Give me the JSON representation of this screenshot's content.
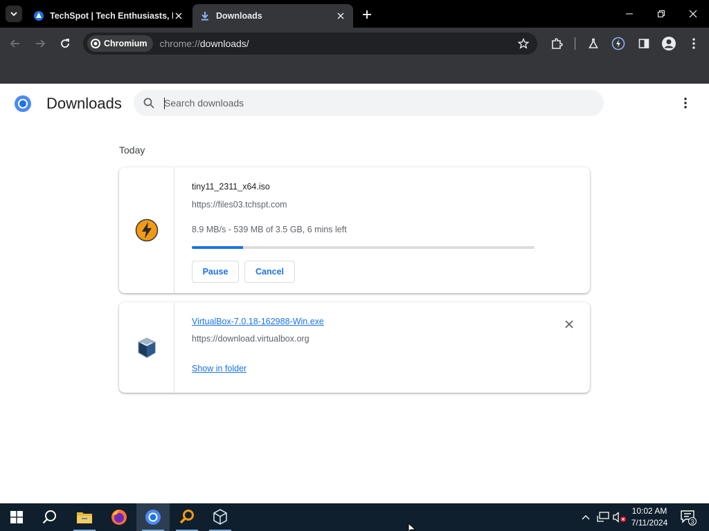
{
  "browser": {
    "tabs": [
      {
        "title": "TechSpot | Tech Enthusiasts, Po",
        "active": false
      },
      {
        "title": "Downloads",
        "active": true
      }
    ],
    "omnibox": {
      "chip_label": "Chromium",
      "url_scheme": "chrome://",
      "url_path": "downloads/"
    }
  },
  "downloads_page": {
    "title": "Downloads",
    "search": {
      "placeholder": "Search downloads",
      "value": ""
    },
    "section_label": "Today",
    "items": [
      {
        "filename": "tiny11_2311_x64.iso",
        "source": "https://files03.tchspt.com",
        "status": "8.9 MB/s - 539 MB of 3.5 GB, 6 mins left",
        "progress_percent": 15,
        "buttons": [
          "Pause",
          "Cancel"
        ],
        "icon": "lightning-bolt-icon"
      },
      {
        "filename": "VirtualBox-7.0.18-162988-Win.exe",
        "source": "https://download.virtualbox.org",
        "action": "Show in folder",
        "icon": "virtualbox-cube-icon"
      }
    ]
  },
  "taskbar": {
    "apps": [
      "start-icon",
      "search-icon",
      "file-explorer-icon",
      "firefox-icon",
      "chromium-icon",
      "search-app-icon",
      "virtualbox-icon"
    ],
    "clock": {
      "time": "10:02 AM",
      "date": "7/11/2024"
    },
    "notification_count": "3"
  },
  "colors": {
    "accent": "#1a73e8",
    "toolbar": "#35363a",
    "tabstrip": "#000000",
    "taskbar": "#0f1f2d"
  }
}
